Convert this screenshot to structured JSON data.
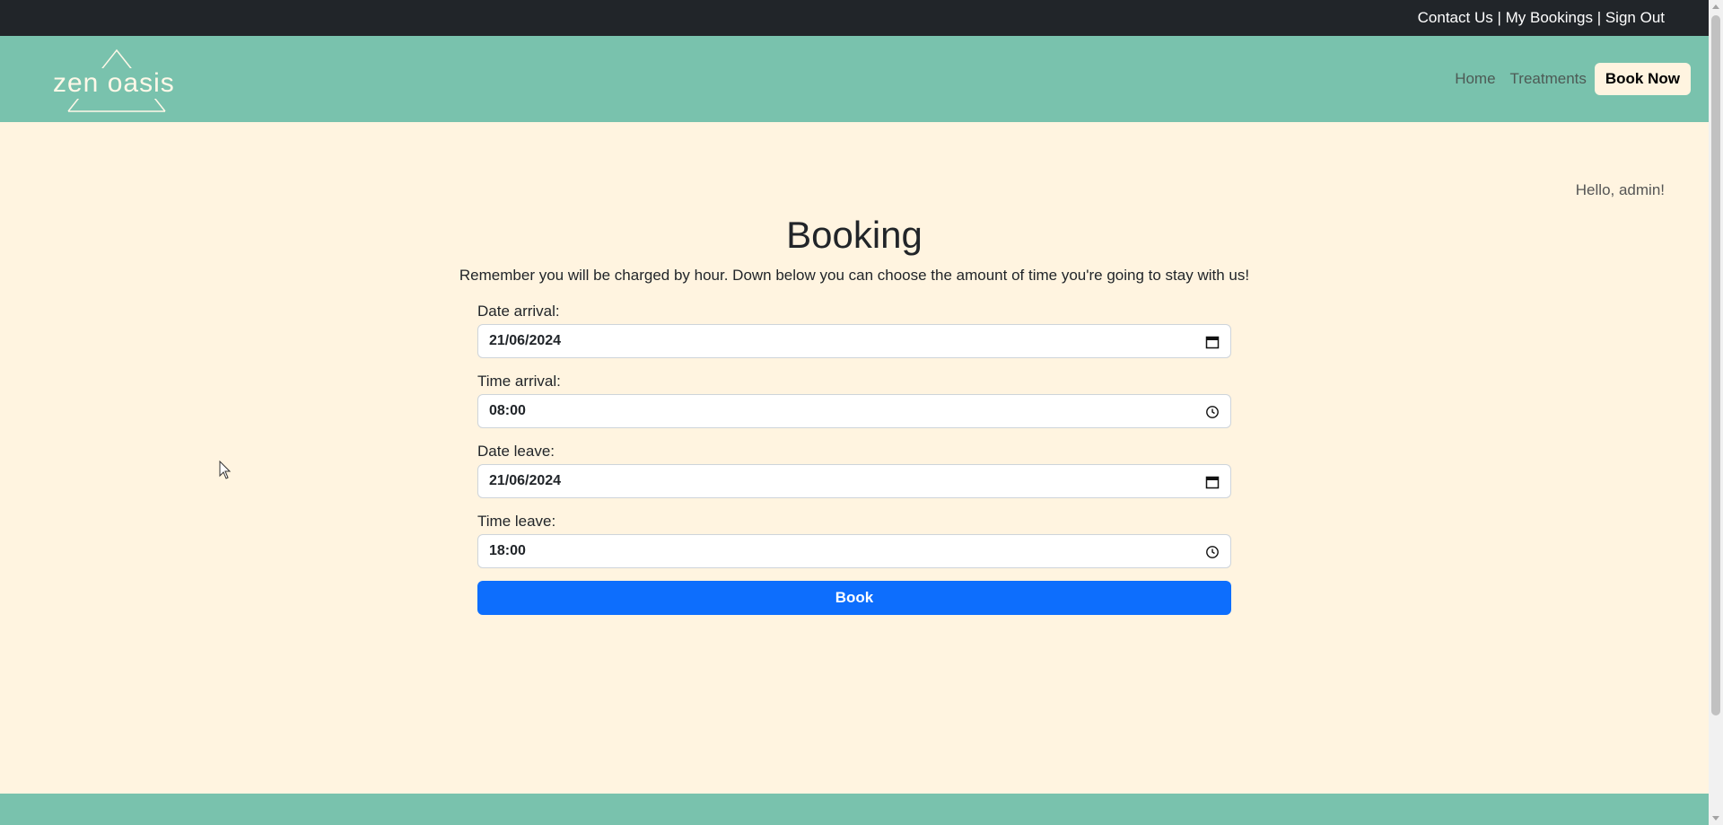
{
  "topbar": {
    "contact": "Contact Us",
    "separator": "|",
    "bookings": "My Bookings",
    "signout": "Sign Out"
  },
  "nav": {
    "logo_text": "zen oasis",
    "home": "Home",
    "treatments": "Treatments",
    "book_now": "Book Now"
  },
  "greeting": "Hello, admin!",
  "page": {
    "title": "Booking",
    "intro": "Remember you will be charged by hour. Down below you can choose the amount of time you're going to stay with us!"
  },
  "form": {
    "date_arrival": {
      "label": "Date arrival:",
      "value": "21/06/2024",
      "icon": "calendar-icon"
    },
    "time_arrival": {
      "label": "Time arrival:",
      "value": "08:00",
      "icon": "clock-icon"
    },
    "date_leave": {
      "label": "Date leave:",
      "value": "21/06/2024",
      "icon": "calendar-icon"
    },
    "time_leave": {
      "label": "Time leave:",
      "value": "18:00",
      "icon": "clock-icon"
    },
    "submit_label": "Book"
  },
  "colors": {
    "topbar": "#212529",
    "navbar": "#79c2ad",
    "background": "#fff4e0",
    "primary_button": "#0d6efd"
  }
}
